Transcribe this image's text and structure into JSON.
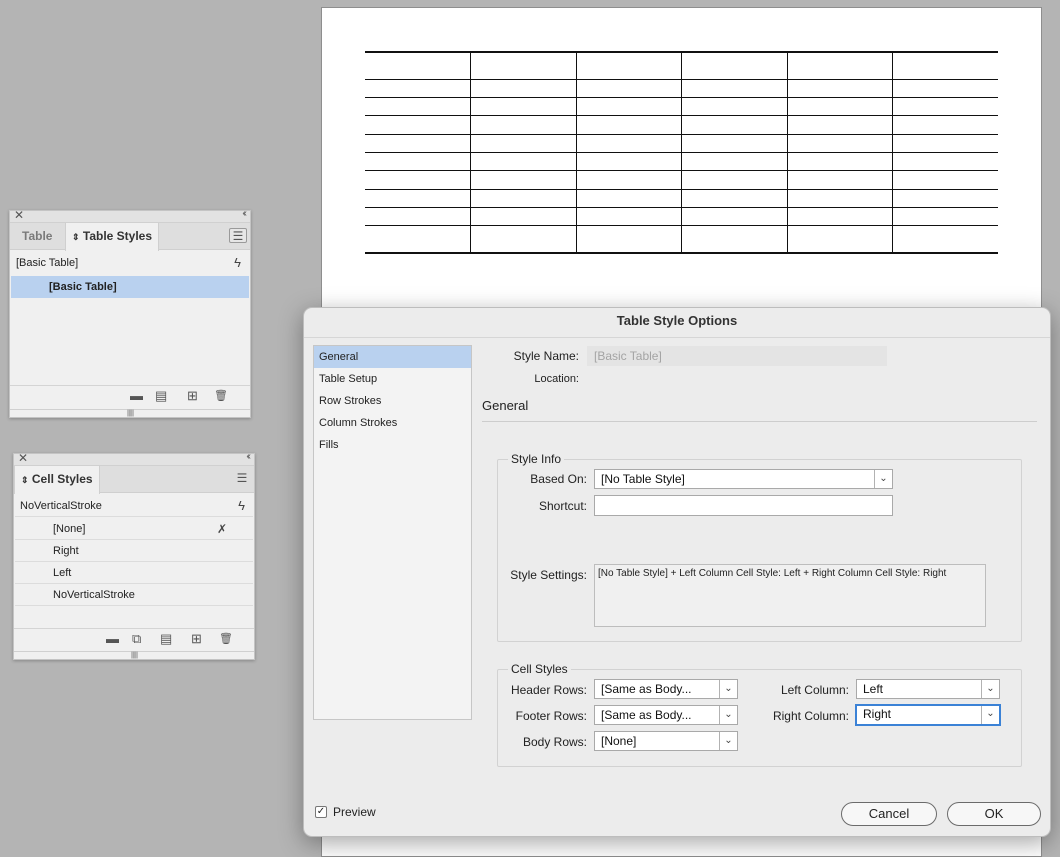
{
  "document": {
    "table": {
      "rows": 10,
      "cols": 6
    }
  },
  "table_styles_panel": {
    "tabs": [
      "Table",
      "Table Styles"
    ],
    "active_tab_index": 1,
    "active_style_header": "[Basic Table]",
    "items": [
      "[Basic Table]"
    ],
    "selected_item_index": 0,
    "icons": {
      "close": "close-icon",
      "collapse": "double-chevron-left-icon",
      "menu": "panel-menu-icon",
      "clear_overrides": "lightning-icon",
      "new_group": "folder-icon",
      "load_styles": "load-styles-icon",
      "new_style": "new-style-icon",
      "delete": "trash-icon"
    },
    "glyphs": {
      "close": "✕",
      "collapse": "‹‹",
      "menu": "☰",
      "bolt": "ϟ",
      "folder": "▬",
      "load": "▤",
      "new": "⊞",
      "trash": "🗑"
    }
  },
  "cell_styles_panel": {
    "tabs": [
      "Cell Styles"
    ],
    "active_style_header": "NoVerticalStroke",
    "items": [
      "[None]",
      "Right",
      "Left",
      "NoVerticalStroke"
    ],
    "icons": {
      "close": "close-icon",
      "collapse": "double-chevron-left-icon",
      "menu": "panel-menu-icon",
      "clear_overrides": "lightning-icon",
      "none_locked": "pencil-crossed-icon",
      "new_group": "folder-icon",
      "map_tags": "map-tags-icon",
      "load_styles": "load-styles-icon",
      "new_style": "new-style-icon",
      "delete": "trash-icon"
    },
    "glyphs": {
      "close": "✕",
      "collapse": "‹‹",
      "menu": "☰",
      "bolt": "ϟ",
      "crossed_pencil": "✗",
      "folder": "▬",
      "map": "⧉",
      "load": "▤",
      "new": "⊞",
      "trash": "🗑",
      "sort": "⇕"
    }
  },
  "dialog": {
    "title": "Table Style Options",
    "categories": [
      "General",
      "Table Setup",
      "Row Strokes",
      "Column Strokes",
      "Fills"
    ],
    "selected_category_index": 0,
    "style_name_label": "Style Name:",
    "style_name_value": "[Basic Table]",
    "location_label": "Location:",
    "section_title": "General",
    "style_info": {
      "legend": "Style Info",
      "based_on_label": "Based On:",
      "based_on_value": "[No Table Style]",
      "shortcut_label": "Shortcut:",
      "shortcut_value": "",
      "style_settings_label": "Style Settings:",
      "style_settings_value": "[No Table Style] + Left Column Cell Style: Left + Right Column Cell Style: Right"
    },
    "cell_styles": {
      "legend": "Cell Styles",
      "header_rows_label": "Header Rows:",
      "header_rows_value": "[Same as Body...",
      "footer_rows_label": "Footer Rows:",
      "footer_rows_value": "[Same as Body...",
      "body_rows_label": "Body Rows:",
      "body_rows_value": "[None]",
      "left_column_label": "Left Column:",
      "left_column_value": "Left",
      "right_column_label": "Right Column:",
      "right_column_value": "Right"
    },
    "preview_label": "Preview",
    "preview_checked": true,
    "check_glyph": "✓",
    "dropdown_glyph": "⌄",
    "cancel_label": "Cancel",
    "ok_label": "OK",
    "accent_color": "#3b82d6",
    "selection_color": "#b9d1ef"
  }
}
